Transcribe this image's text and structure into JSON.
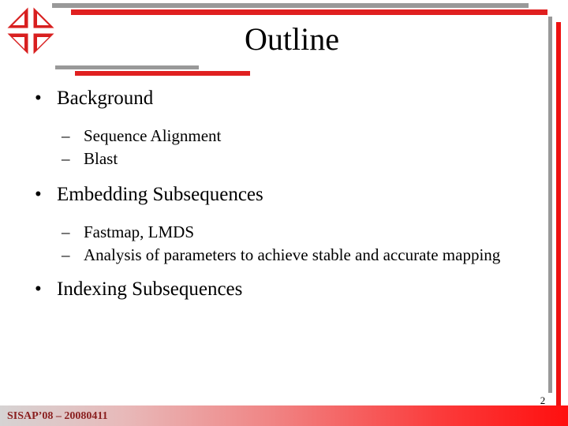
{
  "slide": {
    "title": "Outline",
    "page_number": "2",
    "footer_text": "SISAP’08 – 20080411",
    "logo_name": "sisap-diamond-logo"
  },
  "colors": {
    "accent_red": "#e02020",
    "bright_red": "#ee1111",
    "rule_gray": "#999999",
    "footer_text": "#8a1f1f",
    "text": "#000000"
  },
  "content": {
    "markers": {
      "level1": "•",
      "level2": "–"
    },
    "items": [
      {
        "level": 1,
        "text": "Background"
      },
      {
        "level": 2,
        "text": "Sequence Alignment"
      },
      {
        "level": 2,
        "text": "Blast"
      },
      {
        "level": 1,
        "text": "Embedding Subsequences"
      },
      {
        "level": 2,
        "text": "Fastmap, LMDS"
      },
      {
        "level": 2,
        "text": "Analysis of parameters to achieve stable and accurate mapping"
      },
      {
        "level": 1,
        "text": "Indexing Subsequences"
      }
    ]
  }
}
